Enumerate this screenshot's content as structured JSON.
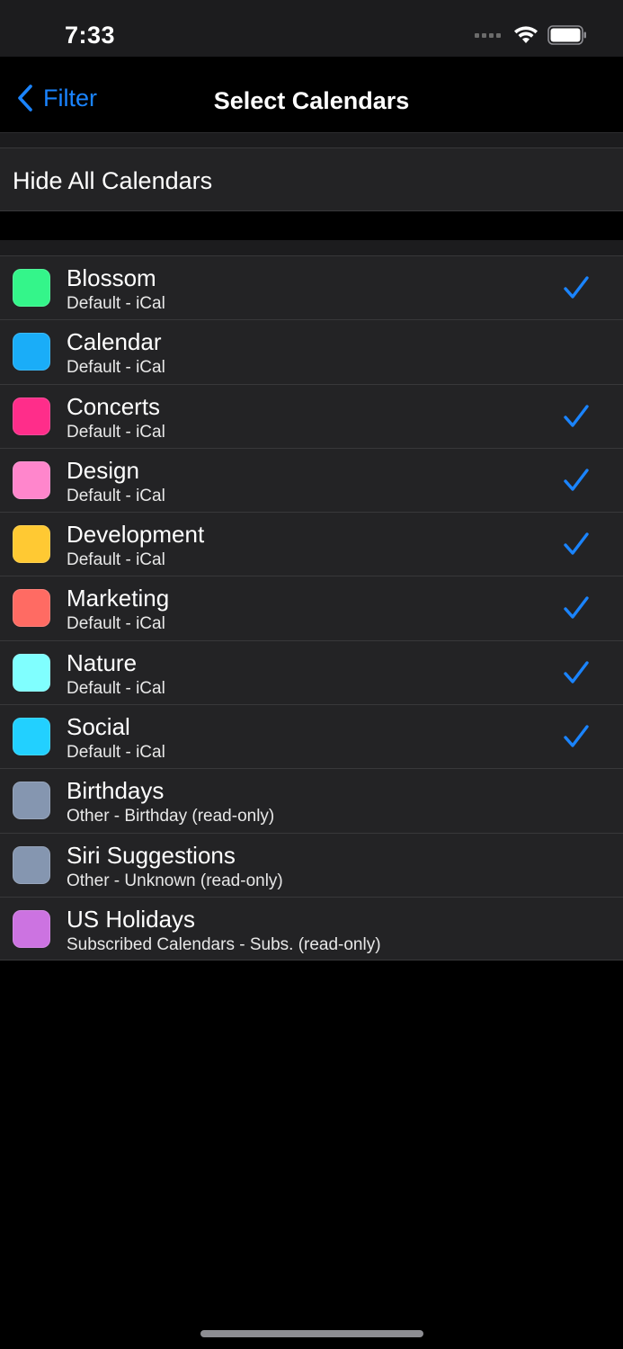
{
  "status": {
    "time": "7:33"
  },
  "nav": {
    "back_label": "Filter",
    "title": "Select Calendars"
  },
  "hide_all_label": "Hide All Calendars",
  "colors": {
    "accent": "#1a84ff",
    "cell_bg": "#232325"
  },
  "calendars": [
    {
      "name": "Blossom",
      "subtitle": "Default - iCal",
      "color": "#34f58a",
      "checked": true
    },
    {
      "name": "Calendar",
      "subtitle": "Default - iCal",
      "color": "#1aadf8",
      "checked": false
    },
    {
      "name": "Concerts",
      "subtitle": "Default - iCal",
      "color": "#ff2d8a",
      "checked": true
    },
    {
      "name": "Design",
      "subtitle": "Default - iCal",
      "color": "#ff86cc",
      "checked": true
    },
    {
      "name": "Development",
      "subtitle": "Default - iCal",
      "color": "#ffc933",
      "checked": true
    },
    {
      "name": "Marketing",
      "subtitle": "Default - iCal",
      "color": "#ff6b63",
      "checked": true
    },
    {
      "name": "Nature",
      "subtitle": "Default - iCal",
      "color": "#80ffff",
      "checked": true
    },
    {
      "name": "Social",
      "subtitle": "Default - iCal",
      "color": "#22d0ff",
      "checked": true
    },
    {
      "name": "Birthdays",
      "subtitle": "Other - Birthday (read-only)",
      "color": "#8596b0",
      "checked": false
    },
    {
      "name": "Siri Suggestions",
      "subtitle": "Other - Unknown (read-only)",
      "color": "#8596b0",
      "checked": false
    },
    {
      "name": "US Holidays",
      "subtitle": "Subscribed Calendars - Subs. (read-only)",
      "color": "#cc73e1",
      "checked": false
    }
  ]
}
